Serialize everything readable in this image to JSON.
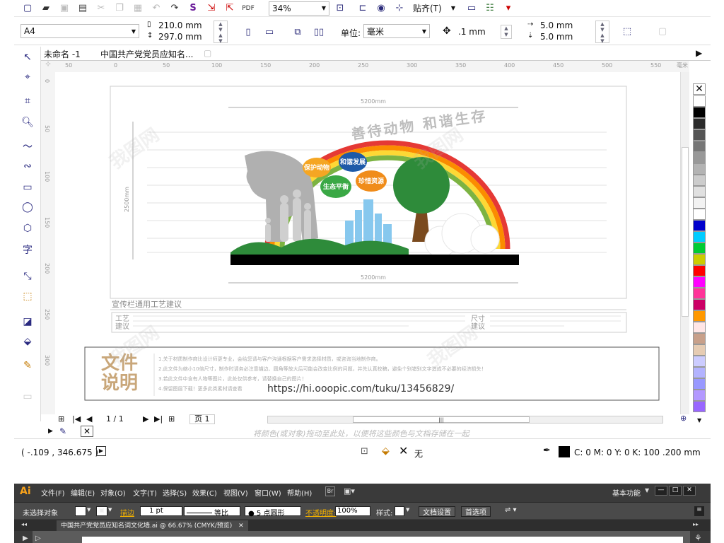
{
  "toolbar": {
    "zoom": "34%",
    "snap_label": "贴齐(T)",
    "page_size": "A4",
    "width": "210.0 mm",
    "height": "297.0 mm",
    "unit_label": "单位:",
    "unit_value": "毫米",
    "nudge": ".1 mm",
    "dup_x": "5.0 mm",
    "dup_y": "5.0 mm"
  },
  "tabs": [
    "未命名 -1",
    "中国共产党党员应知名..."
  ],
  "ruler_ticks": [
    "50",
    "0",
    "50",
    "100",
    "150",
    "200",
    "250",
    "300",
    "350",
    "400",
    "450",
    "500",
    "550"
  ],
  "ruler_unit": "毫米",
  "ruler_v_ticks": [
    "0",
    "50",
    "100",
    "150",
    "200",
    "250",
    "300"
  ],
  "canvas": {
    "dim_top": "5200mm",
    "dim_bottom": "5200mm",
    "dim_side": "2500mm",
    "arch_title": "善待动物 和谐生存",
    "bubbles": [
      "保护动物",
      "和谐发展",
      "生态平衡",
      "珍惜资源"
    ],
    "section_title": "宣传栏通用工艺建议",
    "left_box_label": "工艺\n建议",
    "right_box_label": "尺寸\n建议",
    "file_note_title": "文件\n说明",
    "file_note_lines": [
      "1.关于材质制作商比设计师更专业，会给您请与客户沟通根据客户需求选择材质，或咨询当地制作商。",
      "2.此文件为缩小10倍尺寸，制作时请务必注意描边、圆角等放大后可能会改变比例的问题，并先认真校稿，避免个别错别文字造成不必要的经济损失！",
      "3.若此文件中含有人物等图片，此处仅供参考，请替换自己的图片！",
      "4.保留图层下载！更多此类素材请查看"
    ],
    "url": "https://hi.ooopic.com/tuku/13456829/"
  },
  "page_nav": {
    "current": "1 / 1",
    "page_tab": "页 1"
  },
  "hint_text": "将颜色(或对象)拖动至此处，以便将这些颜色与文档存储在一起",
  "status": {
    "coords": "( -.109 , 346.675 )",
    "fill_none": "无",
    "outline": "C: 0 M: 0 Y: 0 K: 100  .200 mm"
  },
  "palette": [
    "#ffffff",
    "#000000",
    "#2b2b2b",
    "#555555",
    "#777777",
    "#999999",
    "#b3b3b3",
    "#cccccc",
    "#e0e0e0",
    "#f2f2f2",
    "#ffffff",
    "#0000cc",
    "#00ccff",
    "#00cc33",
    "#cccc00",
    "#ff0000",
    "#ff00ff",
    "#ff3399",
    "#cc0066",
    "#ff9900",
    "#ffe6e6",
    "#c8a08a",
    "#e6ccb3",
    "#ccccff",
    "#b3b3ff",
    "#9999ff",
    "#b399ff",
    "#9966ff"
  ],
  "illustrator": {
    "logo": "Ai",
    "menus": [
      "文件(F)",
      "编辑(E)",
      "对象(O)",
      "文字(T)",
      "选择(S)",
      "效果(C)",
      "视图(V)",
      "窗口(W)",
      "帮助(H)"
    ],
    "workspace": "基本功能",
    "no_selection": "未选择对象",
    "stroke_label": "描边",
    "stroke_value": "1 pt",
    "equal_ratio": "等比",
    "brush": "5 点圆形",
    "opacity_label": "不透明度:",
    "opacity_value": "100%",
    "style_label": "样式:",
    "doc_settings": "文档设置",
    "prefs": "首选项",
    "doc_tab": "中国共产党党员应知名词文化墙.ai @ 66.67% (CMYK/预览)"
  }
}
